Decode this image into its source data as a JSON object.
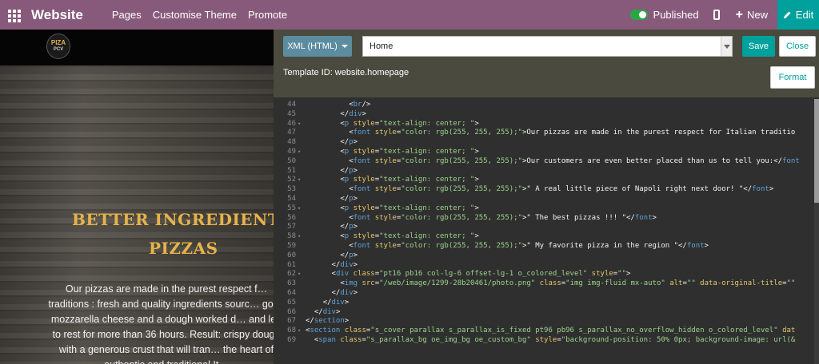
{
  "topbar": {
    "brand": "Website",
    "menu": [
      "Pages",
      "Customise Theme",
      "Promote"
    ],
    "published": "Published",
    "new": "New",
    "edit": "Edit"
  },
  "site": {
    "logo_line1": "PIZA",
    "logo_line2": "PCV",
    "hero_title_line1": "BETTER INGREDIENTS FOR BE",
    "hero_title_line2": "PIZZAS",
    "hero_text": "Our pizzas are made in the purest respect f… traditions : fresh and quality ingredients sourc… good mozzarella cheese and a dough worked d… and left to rest for more than 36 hours. Result: crispy dough with a generous crust that will tran… the heart of authentic and traditional It…"
  },
  "editor": {
    "mode_button": "XML (HTML)",
    "view_select": "Home",
    "save": "Save",
    "close": "Close",
    "template_id": "Template ID: website.homepage",
    "format": "Format",
    "lines": [
      {
        "n": "44",
        "i": 10,
        "fold": false,
        "t": [
          [
            "plain",
            "<"
          ],
          [
            "tag",
            "br"
          ],
          [
            "plain",
            "/>"
          ]
        ]
      },
      {
        "n": "45",
        "i": 8,
        "fold": false,
        "t": [
          [
            "plain",
            "</"
          ],
          [
            "tag",
            "div"
          ],
          [
            "plain",
            ">"
          ]
        ]
      },
      {
        "n": "46",
        "i": 8,
        "fold": true,
        "t": [
          [
            "plain",
            "<"
          ],
          [
            "tag",
            "p"
          ],
          [
            "plain",
            " "
          ],
          [
            "attr",
            "style"
          ],
          [
            "plain",
            "="
          ],
          [
            "str",
            "\"text-align: center; \""
          ],
          [
            "plain",
            ">"
          ]
        ]
      },
      {
        "n": "47",
        "i": 10,
        "fold": false,
        "t": [
          [
            "plain",
            "<"
          ],
          [
            "tag",
            "font"
          ],
          [
            "plain",
            " "
          ],
          [
            "attr",
            "style"
          ],
          [
            "plain",
            "="
          ],
          [
            "str",
            "\"color: rgb(255, 255, 255);\""
          ],
          [
            "plain",
            ">Our pizzas are made in the purest respect for Italian traditio"
          ]
        ]
      },
      {
        "n": "48",
        "i": 8,
        "fold": false,
        "t": [
          [
            "plain",
            "</"
          ],
          [
            "tag",
            "p"
          ],
          [
            "plain",
            ">"
          ]
        ]
      },
      {
        "n": "49",
        "i": 8,
        "fold": true,
        "t": [
          [
            "plain",
            "<"
          ],
          [
            "tag",
            "p"
          ],
          [
            "plain",
            " "
          ],
          [
            "attr",
            "style"
          ],
          [
            "plain",
            "="
          ],
          [
            "str",
            "\"text-align: center; \""
          ],
          [
            "plain",
            ">"
          ]
        ]
      },
      {
        "n": "50",
        "i": 10,
        "fold": false,
        "t": [
          [
            "plain",
            "<"
          ],
          [
            "tag",
            "font"
          ],
          [
            "plain",
            " "
          ],
          [
            "attr",
            "style"
          ],
          [
            "plain",
            "="
          ],
          [
            "str",
            "\"color: rgb(255, 255, 255);\""
          ],
          [
            "plain",
            ">Our customers are even better placed than us to tell you:</"
          ],
          [
            "tag",
            "font"
          ]
        ]
      },
      {
        "n": "51",
        "i": 8,
        "fold": false,
        "t": [
          [
            "plain",
            "</"
          ],
          [
            "tag",
            "p"
          ],
          [
            "plain",
            ">"
          ]
        ]
      },
      {
        "n": "52",
        "i": 8,
        "fold": true,
        "t": [
          [
            "plain",
            "<"
          ],
          [
            "tag",
            "p"
          ],
          [
            "plain",
            " "
          ],
          [
            "attr",
            "style"
          ],
          [
            "plain",
            "="
          ],
          [
            "str",
            "\"text-align: center; \""
          ],
          [
            "plain",
            ">"
          ]
        ]
      },
      {
        "n": "53",
        "i": 10,
        "fold": false,
        "t": [
          [
            "plain",
            "<"
          ],
          [
            "tag",
            "font"
          ],
          [
            "plain",
            " "
          ],
          [
            "attr",
            "style"
          ],
          [
            "plain",
            "="
          ],
          [
            "str",
            "\"color: rgb(255, 255, 255);\""
          ],
          [
            "plain",
            ">\" A real little piece of Napoli right next door! \"</"
          ],
          [
            "tag",
            "font"
          ],
          [
            "plain",
            ">"
          ]
        ]
      },
      {
        "n": "54",
        "i": 8,
        "fold": false,
        "t": [
          [
            "plain",
            "</"
          ],
          [
            "tag",
            "p"
          ],
          [
            "plain",
            ">"
          ]
        ]
      },
      {
        "n": "55",
        "i": 8,
        "fold": true,
        "t": [
          [
            "plain",
            "<"
          ],
          [
            "tag",
            "p"
          ],
          [
            "plain",
            " "
          ],
          [
            "attr",
            "style"
          ],
          [
            "plain",
            "="
          ],
          [
            "str",
            "\"text-align: center; \""
          ],
          [
            "plain",
            ">"
          ]
        ]
      },
      {
        "n": "56",
        "i": 10,
        "fold": false,
        "t": [
          [
            "plain",
            "<"
          ],
          [
            "tag",
            "font"
          ],
          [
            "plain",
            " "
          ],
          [
            "attr",
            "style"
          ],
          [
            "plain",
            "="
          ],
          [
            "str",
            "\"color: rgb(255, 255, 255);\""
          ],
          [
            "plain",
            ">\" The best pizzas !!! \"</"
          ],
          [
            "tag",
            "font"
          ],
          [
            "plain",
            ">"
          ]
        ]
      },
      {
        "n": "57",
        "i": 8,
        "fold": false,
        "t": [
          [
            "plain",
            "</"
          ],
          [
            "tag",
            "p"
          ],
          [
            "plain",
            ">"
          ]
        ]
      },
      {
        "n": "58",
        "i": 8,
        "fold": true,
        "t": [
          [
            "plain",
            "<"
          ],
          [
            "tag",
            "p"
          ],
          [
            "plain",
            " "
          ],
          [
            "attr",
            "style"
          ],
          [
            "plain",
            "="
          ],
          [
            "str",
            "\"text-align: center; \""
          ],
          [
            "plain",
            ">"
          ]
        ]
      },
      {
        "n": "59",
        "i": 10,
        "fold": false,
        "t": [
          [
            "plain",
            "<"
          ],
          [
            "tag",
            "font"
          ],
          [
            "plain",
            " "
          ],
          [
            "attr",
            "style"
          ],
          [
            "plain",
            "="
          ],
          [
            "str",
            "\"color: rgb(255, 255, 255);\""
          ],
          [
            "plain",
            ">\" My favorite pizza in the region \"</"
          ],
          [
            "tag",
            "font"
          ],
          [
            "plain",
            ">"
          ]
        ]
      },
      {
        "n": "60",
        "i": 8,
        "fold": false,
        "t": [
          [
            "plain",
            "</"
          ],
          [
            "tag",
            "p"
          ],
          [
            "plain",
            ">"
          ]
        ]
      },
      {
        "n": "61",
        "i": 6,
        "fold": false,
        "t": [
          [
            "plain",
            "</"
          ],
          [
            "tag",
            "div"
          ],
          [
            "plain",
            ">"
          ]
        ]
      },
      {
        "n": "62",
        "i": 6,
        "fold": true,
        "t": [
          [
            "plain",
            "<"
          ],
          [
            "tag",
            "div"
          ],
          [
            "plain",
            " "
          ],
          [
            "attr",
            "class"
          ],
          [
            "plain",
            "="
          ],
          [
            "str",
            "\"pt16 pb16 col-lg-6 offset-lg-1 o_colored_level\""
          ],
          [
            "plain",
            " "
          ],
          [
            "attr",
            "style"
          ],
          [
            "plain",
            "="
          ],
          [
            "str",
            "\"\""
          ],
          [
            "plain",
            ">"
          ]
        ]
      },
      {
        "n": "63",
        "i": 8,
        "fold": false,
        "t": [
          [
            "plain",
            "<"
          ],
          [
            "tag",
            "img"
          ],
          [
            "plain",
            " "
          ],
          [
            "attr",
            "src"
          ],
          [
            "plain",
            "="
          ],
          [
            "str",
            "\"/web/image/1299-28b20461/photo.png\""
          ],
          [
            "plain",
            " "
          ],
          [
            "attr",
            "class"
          ],
          [
            "plain",
            "="
          ],
          [
            "str",
            "\"img img-fluid mx-auto\""
          ],
          [
            "plain",
            " "
          ],
          [
            "attr",
            "alt"
          ],
          [
            "plain",
            "="
          ],
          [
            "str",
            "\"\""
          ],
          [
            "plain",
            " "
          ],
          [
            "attr",
            "data-original-title"
          ],
          [
            "plain",
            "="
          ],
          [
            "str",
            "\"\""
          ]
        ]
      },
      {
        "n": "64",
        "i": 6,
        "fold": false,
        "t": [
          [
            "plain",
            "</"
          ],
          [
            "tag",
            "div"
          ],
          [
            "plain",
            ">"
          ]
        ]
      },
      {
        "n": "65",
        "i": 4,
        "fold": false,
        "t": [
          [
            "plain",
            "</"
          ],
          [
            "tag",
            "div"
          ],
          [
            "plain",
            ">"
          ]
        ]
      },
      {
        "n": "66",
        "i": 2,
        "fold": false,
        "t": [
          [
            "plain",
            "</"
          ],
          [
            "tag",
            "div"
          ],
          [
            "plain",
            ">"
          ]
        ]
      },
      {
        "n": "67",
        "i": 0,
        "fold": false,
        "t": [
          [
            "plain",
            "</"
          ],
          [
            "tag",
            "section"
          ],
          [
            "plain",
            ">"
          ]
        ]
      },
      {
        "n": "68",
        "i": 0,
        "fold": true,
        "t": [
          [
            "plain",
            "<"
          ],
          [
            "tag",
            "section"
          ],
          [
            "plain",
            " "
          ],
          [
            "attr",
            "class"
          ],
          [
            "plain",
            "="
          ],
          [
            "str",
            "\"s_cover parallax s_parallax_is_fixed pt96 pb96 s_parallax_no_overflow_hidden o_colored_level\""
          ],
          [
            "plain",
            " "
          ],
          [
            "attr",
            "dat"
          ]
        ]
      },
      {
        "n": "69",
        "i": 2,
        "fold": false,
        "t": [
          [
            "plain",
            "<"
          ],
          [
            "tag",
            "span"
          ],
          [
            "plain",
            " "
          ],
          [
            "attr",
            "class"
          ],
          [
            "plain",
            "="
          ],
          [
            "str",
            "\"s_parallax_bg oe_img_bg oe_custom_bg\""
          ],
          [
            "plain",
            " "
          ],
          [
            "attr",
            "style"
          ],
          [
            "plain",
            "="
          ],
          [
            "str",
            "\"background-position: 50% 0px; background-image: url(&"
          ]
        ]
      }
    ]
  },
  "colors": {
    "topbar": "#875a7b",
    "accent": "#00a09d",
    "hero_title": "#e6b34a"
  }
}
